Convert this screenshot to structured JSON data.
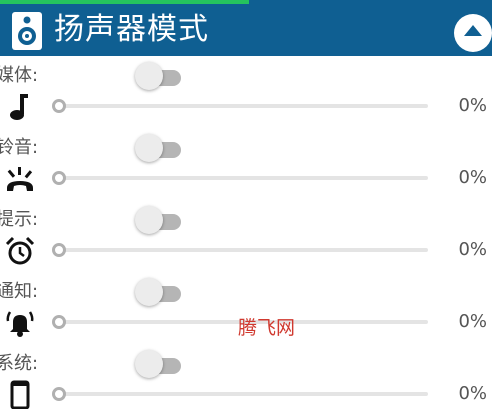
{
  "header": {
    "title": "扬声器模式",
    "speaker_icon": "speaker-icon",
    "collapse_icon": "chevron-up-icon",
    "background_color": "#0f5f92",
    "progress_color": "#25c35e"
  },
  "rows": [
    {
      "label": "媒体:",
      "icon": "music-note-icon",
      "toggle_on": false,
      "volume_percent": "0%"
    },
    {
      "label": "铃音:",
      "icon": "ringing-phone-icon",
      "toggle_on": false,
      "volume_percent": "0%"
    },
    {
      "label": "提示:",
      "icon": "alarm-clock-icon",
      "toggle_on": false,
      "volume_percent": "0%"
    },
    {
      "label": "通知:",
      "icon": "bell-icon",
      "toggle_on": false,
      "volume_percent": "0%"
    },
    {
      "label": "系统:",
      "icon": "phone-device-icon",
      "toggle_on": false,
      "volume_percent": "0%"
    }
  ],
  "watermark": {
    "text": "腾飞网",
    "color": "#d0392f"
  }
}
